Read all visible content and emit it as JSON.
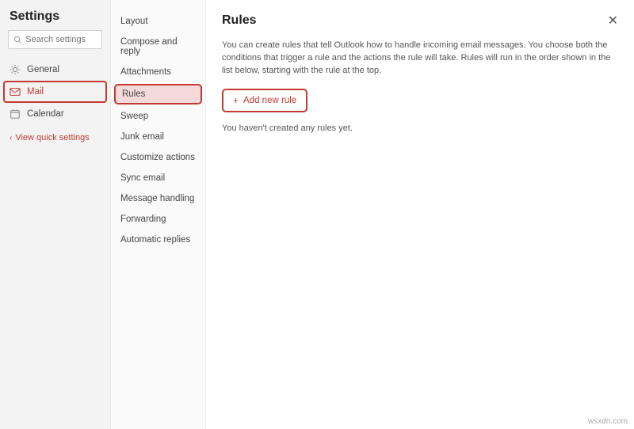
{
  "title": "Settings",
  "search": {
    "placeholder": "Search settings"
  },
  "leftNav": {
    "items": [
      {
        "label": "General",
        "icon": "gear"
      },
      {
        "label": "Mail",
        "icon": "mail"
      },
      {
        "label": "Calendar",
        "icon": "calendar"
      }
    ],
    "quickSettings": "View quick settings"
  },
  "midNav": {
    "items": [
      "Layout",
      "Compose and reply",
      "Attachments",
      "Rules",
      "Sweep",
      "Junk email",
      "Customize actions",
      "Sync email",
      "Message handling",
      "Forwarding",
      "Automatic replies"
    ]
  },
  "main": {
    "title": "Rules",
    "description": "You can create rules that tell Outlook how to handle incoming email messages. You choose both the conditions that trigger a rule and the actions the rule will take. Rules will run in the order shown in the list below, starting with the rule at the top.",
    "addButton": "Add new rule",
    "emptyState": "You haven't created any rules yet."
  },
  "watermark": "wsxdn.com"
}
